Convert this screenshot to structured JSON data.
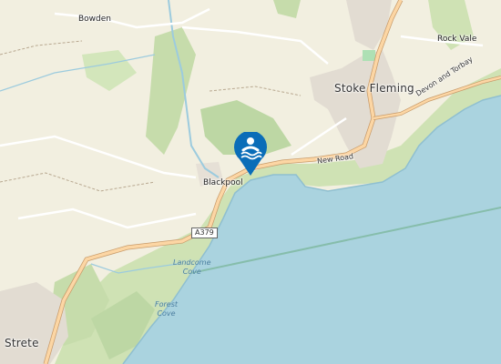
{
  "map": {
    "places": {
      "bowden": "Bowden",
      "blackpool": "Blackpool",
      "stoke_fleming": "Stoke Fleming",
      "rock_vale": "Rock Vale",
      "strete": "Strete"
    },
    "roads": {
      "new_road": "New Road",
      "a379": "A379",
      "devon_and_torbay": "Devon and Torbay"
    },
    "coast": {
      "landcombe_line1": "Landcome",
      "landcombe_line2": "Cove",
      "forest_line1": "Forest",
      "forest_line2": "Cove"
    },
    "marker": {
      "icon": "swimming-icon",
      "color": "#0a6db8"
    },
    "colors": {
      "land": "#f2efe0",
      "sea": "#aad3df",
      "wood": "#c8deb0",
      "road_primary": "#fcd6a4",
      "water_line": "#9ccbde"
    }
  }
}
